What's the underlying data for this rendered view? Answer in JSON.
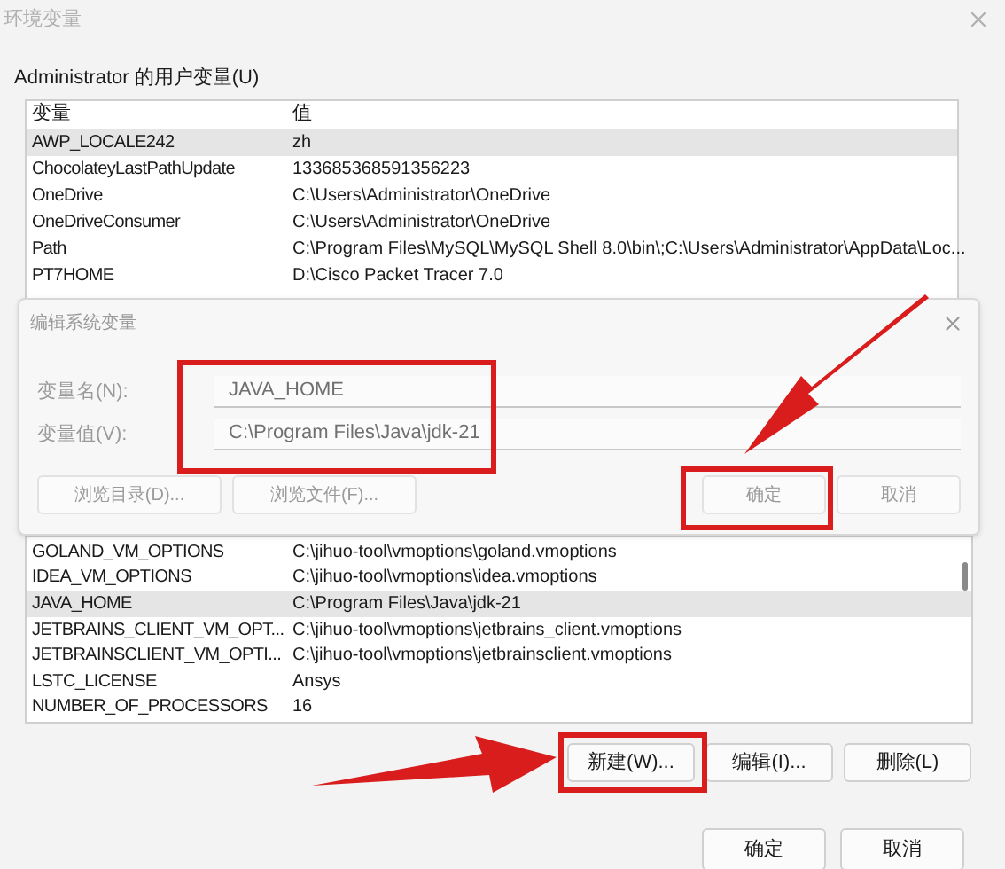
{
  "window": {
    "title": "环境变量"
  },
  "user_variables": {
    "label": "Administrator 的用户变量(U)",
    "columns": [
      "变量",
      "值"
    ],
    "rows": [
      {
        "name": "AWP_LOCALE242",
        "value": "zh",
        "selected": true
      },
      {
        "name": "ChocolateyLastPathUpdate",
        "value": "133685368591356223",
        "selected": false
      },
      {
        "name": "OneDrive",
        "value": "C:\\Users\\Administrator\\OneDrive",
        "selected": false
      },
      {
        "name": "OneDriveConsumer",
        "value": "C:\\Users\\Administrator\\OneDrive",
        "selected": false
      },
      {
        "name": "Path",
        "value": "C:\\Program Files\\MySQL\\MySQL Shell 8.0\\bin\\;C:\\Users\\Administrator\\AppData\\Loc...",
        "selected": false
      },
      {
        "name": "PT7HOME",
        "value": "D:\\Cisco Packet Tracer 7.0",
        "selected": false
      }
    ]
  },
  "edit_dialog": {
    "title": "编辑系统变量",
    "fields": [
      {
        "label": "变量名(N):",
        "value": "JAVA_HOME"
      },
      {
        "label": "变量值(V):",
        "value": "C:\\Program Files\\Java\\jdk-21"
      }
    ],
    "left_buttons": [
      "浏览目录(D)...",
      "浏览文件(F)..."
    ],
    "right_buttons": [
      "确定",
      "取消"
    ]
  },
  "system_variables": {
    "rows": [
      {
        "name": "GOLAND_VM_OPTIONS",
        "value": "C:\\jihuo-tool\\vmoptions\\goland.vmoptions",
        "selected": false
      },
      {
        "name": "IDEA_VM_OPTIONS",
        "value": "C:\\jihuo-tool\\vmoptions\\idea.vmoptions",
        "selected": false
      },
      {
        "name": "JAVA_HOME",
        "value": "C:\\Program Files\\Java\\jdk-21",
        "selected": true
      },
      {
        "name": "JETBRAINS_CLIENT_VM_OPT...",
        "value": "C:\\jihuo-tool\\vmoptions\\jetbrains_client.vmoptions",
        "selected": false
      },
      {
        "name": "JETBRAINSCLIENT_VM_OPTI...",
        "value": "C:\\jihuo-tool\\vmoptions\\jetbrainsclient.vmoptions",
        "selected": false
      },
      {
        "name": "LSTC_LICENSE",
        "value": "Ansys",
        "selected": false
      },
      {
        "name": "NUMBER_OF_PROCESSORS",
        "value": "16",
        "selected": false
      }
    ],
    "buttons": [
      "新建(W)...",
      "编辑(I)...",
      "删除(L)"
    ]
  },
  "buttons": [
    "确定",
    "取消"
  ]
}
